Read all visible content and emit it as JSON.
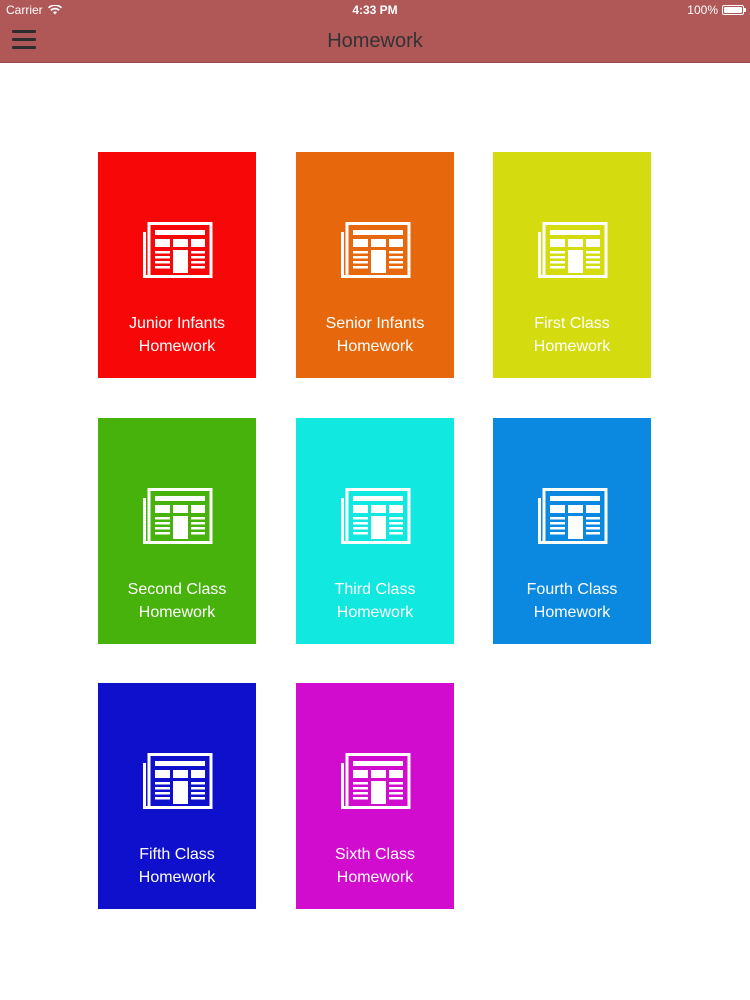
{
  "status_bar": {
    "carrier": "Carrier",
    "time": "4:33 PM",
    "battery": "100%"
  },
  "header": {
    "title": "Homework"
  },
  "tiles": [
    {
      "line1": "Junior Infants",
      "line2": "Homework",
      "color": "#f70707"
    },
    {
      "line1": "Senior Infants",
      "line2": "Homework",
      "color": "#e7680c"
    },
    {
      "line1": "First Class",
      "line2": "Homework",
      "color": "#d4dc10"
    },
    {
      "line1": "Second Class",
      "line2": "Homework",
      "color": "#46b20b"
    },
    {
      "line1": "Third Class",
      "line2": "Homework",
      "color": "#10e8e0"
    },
    {
      "line1": "Fourth Class",
      "line2": "Homework",
      "color": "#0b88e0"
    },
    {
      "line1": "Fifth Class",
      "line2": "Homework",
      "color": "#0f10cc"
    },
    {
      "line1": "Sixth Class",
      "line2": "Homework",
      "color": "#d20ccf"
    }
  ]
}
